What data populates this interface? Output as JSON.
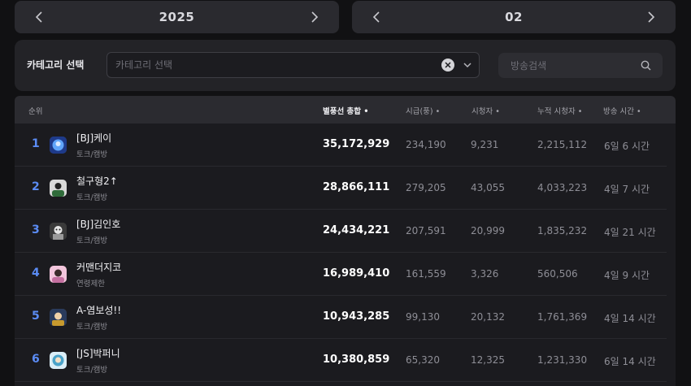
{
  "year_selector": {
    "value": "2025"
  },
  "month_selector": {
    "value": "02"
  },
  "filter": {
    "label": "카테고리 선택",
    "category_placeholder": "카테고리 선택",
    "search_placeholder": "방송검색"
  },
  "table": {
    "headers": {
      "rank": "순위",
      "total": "별풍선 총합",
      "hourly": "시급(풍)",
      "viewers": "시청자",
      "cumulative": "누적 시청자",
      "broadcast_time": "방송 시간"
    },
    "rows": [
      {
        "rank": "1",
        "name": "[BJ]케이",
        "category": "토크/캠방",
        "total": "35,172,929",
        "hourly": "234,190",
        "viewers": "9,231",
        "cumulative": "2,215,112",
        "broadcast_time": "6일 6 시간",
        "avatar_color": "#3b82f6"
      },
      {
        "rank": "2",
        "name": "철구형2↑",
        "category": "토크/캠방",
        "total": "28,866,111",
        "hourly": "279,205",
        "viewers": "43,055",
        "cumulative": "4,033,223",
        "broadcast_time": "4일 7 시간",
        "avatar_color": "#2f6b3a"
      },
      {
        "rank": "3",
        "name": "[BJ]김인호",
        "category": "토크/캠방",
        "total": "24,434,221",
        "hourly": "207,591",
        "viewers": "20,999",
        "cumulative": "1,835,232",
        "broadcast_time": "4일 21 시간",
        "avatar_color": "#9a9a9a"
      },
      {
        "rank": "4",
        "name": "커맨더지코",
        "category": "연령제한",
        "total": "16,989,410",
        "hourly": "161,559",
        "viewers": "3,326",
        "cumulative": "560,506",
        "broadcast_time": "4일 9 시간",
        "avatar_color": "#c46fa0"
      },
      {
        "rank": "5",
        "name": "A-염보성!!",
        "category": "토크/캠방",
        "total": "10,943,285",
        "hourly": "99,130",
        "viewers": "20,132",
        "cumulative": "1,761,369",
        "broadcast_time": "4일 14 시간",
        "avatar_color": "#c79a2e"
      },
      {
        "rank": "6",
        "name": "[JS]박퍼니",
        "category": "토크/캠방",
        "total": "10,380,859",
        "hourly": "65,320",
        "viewers": "12,325",
        "cumulative": "1,231,330",
        "broadcast_time": "6일 14 시간",
        "avatar_color": "#4aa3c9"
      }
    ]
  },
  "colors": {
    "accent_rank": "#5b8cf5",
    "background": "#111113",
    "panel": "#232327"
  },
  "icons": {
    "prev": "chevron-left-icon",
    "next": "chevron-right-icon",
    "clear": "clear-icon",
    "dropdown": "chevron-down-icon",
    "search": "search-icon",
    "sort": "sort-dot-icon"
  }
}
